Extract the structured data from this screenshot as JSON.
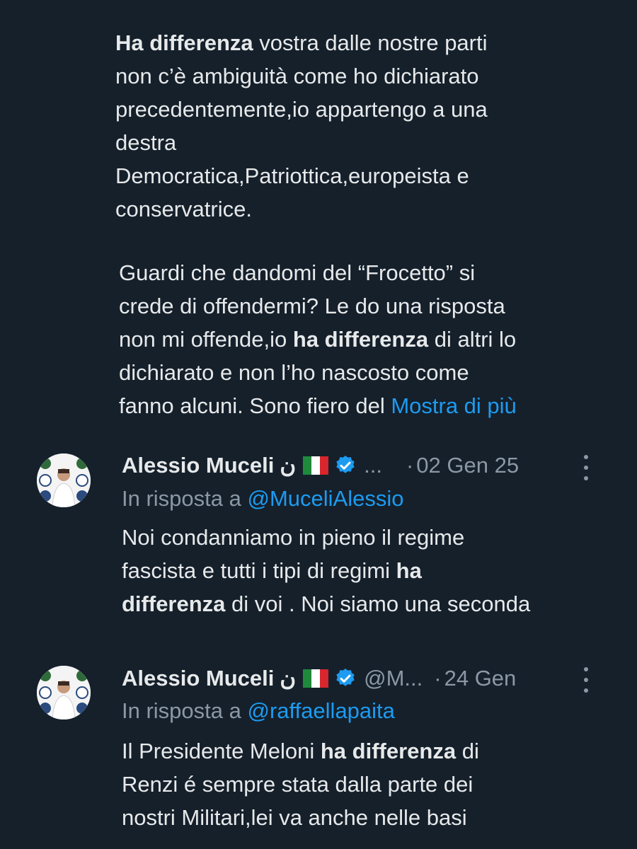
{
  "colors": {
    "background": "#15202b",
    "text": "#e7e9ea",
    "secondary": "#8b98a5",
    "link": "#1d9bf0",
    "verified": "#1d9bf0"
  },
  "main_tweet": {
    "p1": {
      "bold": "Ha differenza",
      "rest": " vostra dalle nostre parti\nnon c’è ambiguità come ho dichiarato\nprecedentemente,io appartengo a una\ndestra\nDemocratica,Patriottica,europeista e\nconservatrice."
    },
    "p2": {
      "before": "Guardi che dandomi del “Frocetto” si\ncrede di offendermi? Le do una risposta\nnon mi offende,io ",
      "bold": "ha differenza",
      "after": " di altri lo\ndichiarato e non l’ho nascosto come\nfanno alcuni. Sono fiero del ",
      "show_more": "Mostra di più"
    }
  },
  "replies": [
    {
      "name": "Alessio Muceli",
      "rtl_char": "ن",
      "flag_icon": "italian-flag-icon",
      "verified_icon": "verified-badge-icon",
      "handle": "...",
      "separator": "·",
      "time": "02 Gen 25",
      "reply_prefix": "In risposta a ",
      "reply_handle": "@MuceliAlessio",
      "lines": [
        {
          "a": "Noi condanniamo in pieno il regime"
        },
        {
          "a": "fascista e tutti i tipi di regimi ",
          "b": "ha"
        },
        {
          "b": "differenza",
          "c": " di voi . Noi siamo una seconda"
        }
      ]
    },
    {
      "name": "Alessio Muceli",
      "rtl_char": "ن",
      "flag_icon": "italian-flag-icon",
      "verified_icon": "verified-badge-icon",
      "handle": "@M...",
      "separator": "·",
      "time": "24 Gen",
      "reply_prefix": "In risposta a ",
      "reply_handle": "@raffaellapaita",
      "lines": [
        {
          "a": "Il Presidente Meloni ",
          "b": "ha differenza",
          "c": " di"
        },
        {
          "a": "Renzi é sempre stata dalla parte dei"
        },
        {
          "a": "nostri Militari,lei va anche nelle basi"
        }
      ]
    }
  ]
}
